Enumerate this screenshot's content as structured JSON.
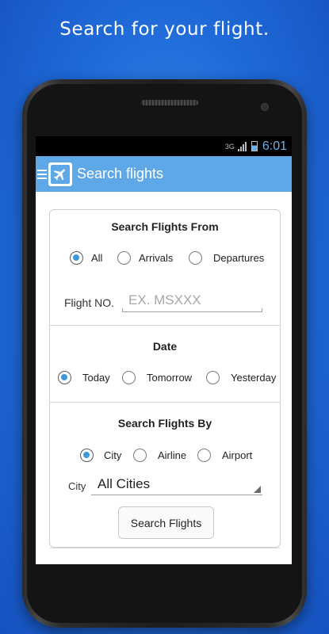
{
  "headline": "Search for your flight.",
  "status_bar": {
    "network": "3G",
    "time": "6:01"
  },
  "action_bar": {
    "title": "Search flights"
  },
  "search_from": {
    "title": "Search Flights From",
    "options": [
      "All",
      "Arrivals",
      "Departures"
    ],
    "selected": "All"
  },
  "flight_no": {
    "label": "Flight NO.",
    "placeholder": "EX. MSXXX"
  },
  "date": {
    "title": "Date",
    "options": [
      "Today",
      "Tomorrow",
      "Yesterday"
    ],
    "selected": "Today"
  },
  "search_by": {
    "title": "Search Flights By",
    "options": [
      "City",
      "Airline",
      "Airport"
    ],
    "selected": "City"
  },
  "city": {
    "label": "City",
    "value": "All Cities"
  },
  "search_button": {
    "label": "Search Flights"
  },
  "colors": {
    "accent": "#3a9ad9",
    "action_bar": "#5fa8e8",
    "background": "#1f6ad8"
  }
}
